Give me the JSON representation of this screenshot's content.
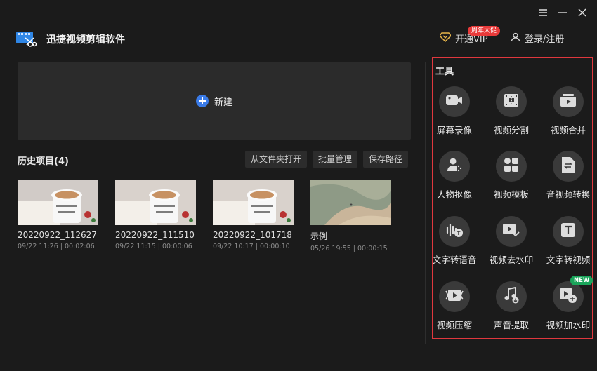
{
  "header": {
    "app_title": "迅捷视频剪辑软件",
    "vip_label": "开通VIP",
    "vip_badge": "周年大促",
    "login_label": "登录/注册"
  },
  "main": {
    "new_label": "新建",
    "history_title": "历史项目(4)",
    "buttons": {
      "open_folder": "从文件夹打开",
      "batch": "批量管理",
      "save_path": "保存路径"
    },
    "projects": [
      {
        "name": "20220922_112627",
        "meta": "09/22 11:26 | 00:02:06"
      },
      {
        "name": "20220922_111510",
        "meta": "09/22 11:15 | 00:00:06"
      },
      {
        "name": "20220922_101718",
        "meta": "09/22 10:17 | 00:00:10"
      },
      {
        "name": "示例",
        "meta": "05/26 19:55 | 00:00:15"
      }
    ]
  },
  "tools": {
    "title": "工具",
    "new_badge": "NEW",
    "items": [
      {
        "label": "屏幕录像",
        "icon": "camera-icon"
      },
      {
        "label": "视频分割",
        "icon": "film-split-icon"
      },
      {
        "label": "视频合并",
        "icon": "video-merge-icon"
      },
      {
        "label": "人物抠像",
        "icon": "person-cutout-icon"
      },
      {
        "label": "视频模板",
        "icon": "template-icon"
      },
      {
        "label": "音视频转换",
        "icon": "convert-icon"
      },
      {
        "label": "文字转语音",
        "icon": "text-to-speech-icon"
      },
      {
        "label": "视频去水印",
        "icon": "remove-watermark-icon"
      },
      {
        "label": "文字转视频",
        "icon": "text-to-video-icon"
      },
      {
        "label": "视频压缩",
        "icon": "compress-icon"
      },
      {
        "label": "声音提取",
        "icon": "audio-extract-icon"
      },
      {
        "label": "视频加水印",
        "icon": "add-watermark-icon"
      }
    ]
  },
  "colors": {
    "accent_blue": "#3a7be8",
    "badge_red": "#e83a3a",
    "new_green": "#1aa55a",
    "highlight_border": "#e0383e"
  }
}
